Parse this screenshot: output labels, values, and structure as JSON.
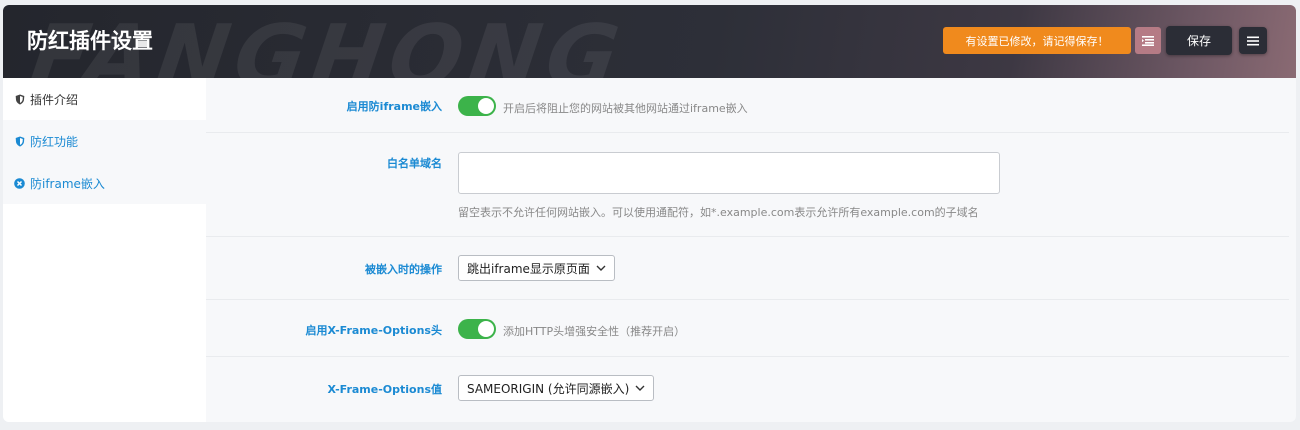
{
  "header": {
    "title": "防红插件设置",
    "watermark": "FANGHONG",
    "notice": "有设置已修改，请记得保存！",
    "save_label": "保存"
  },
  "sidebar": {
    "items": [
      {
        "label": "插件介绍",
        "icon": "shield-icon"
      },
      {
        "label": "防红功能",
        "icon": "shield-icon"
      },
      {
        "label": "防iframe嵌入",
        "icon": "close-circle-icon"
      }
    ]
  },
  "settings": {
    "enable_anti_iframe": {
      "label": "启用防iframe嵌入",
      "enabled": true,
      "hint": "开启后将阻止您的网站被其他网站通过iframe嵌入"
    },
    "whitelist": {
      "label": "白名单域名",
      "value": "",
      "hint": "留空表示不允许任何网站嵌入。可以使用通配符，如*.example.com表示允许所有example.com的子域名"
    },
    "embed_action": {
      "label": "被嵌入时的操作",
      "selected": "跳出iframe显示原页面"
    },
    "enable_xfo": {
      "label": "启用X-Frame-Options头",
      "enabled": true,
      "hint": "添加HTTP头增强安全性（推荐开启）"
    },
    "xfo_value": {
      "label": "X-Frame-Options值",
      "selected": "SAMEORIGIN (允许同源嵌入)"
    }
  },
  "colors": {
    "accent": "#1b8ad3",
    "notice": "#f08a1d",
    "toggle_on": "#3cb34a"
  }
}
